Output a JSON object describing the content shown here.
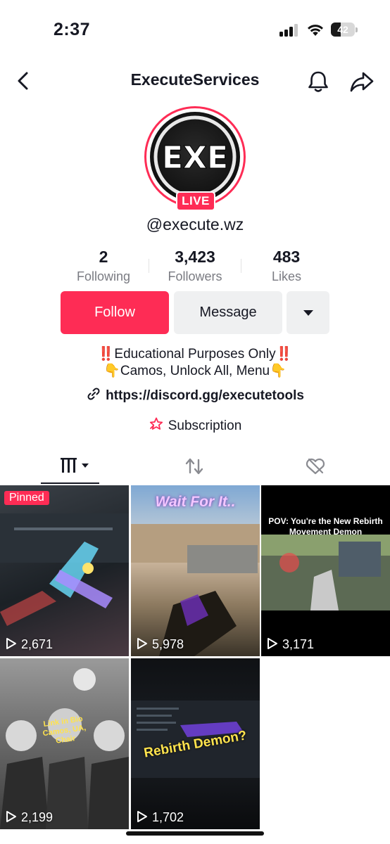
{
  "status_bar": {
    "time": "2:37",
    "battery_level": "42",
    "battery_fraction": 0.42,
    "signal_bars_active": 3
  },
  "header": {
    "title": "ExecuteServices"
  },
  "profile": {
    "live_label": "LIVE",
    "username": "@execute.wz",
    "avatar_logo_text": "EXE",
    "stats": [
      {
        "value": "2",
        "label": "Following"
      },
      {
        "value": "3,423",
        "label": "Followers"
      },
      {
        "value": "483",
        "label": "Likes"
      }
    ],
    "follow_label": "Follow",
    "message_label": "Message",
    "bio_line1": "‼️Educational Purposes Only‼️",
    "bio_line2": "👇Camos, Unlock All, Menu👇",
    "link": "https://discord.gg/executetools",
    "subscription_label": "Subscription"
  },
  "tabs": [
    {
      "icon": "grid-icon",
      "active": true
    },
    {
      "icon": "repost-icon",
      "active": false
    },
    {
      "icon": "liked-hidden-icon",
      "active": false
    }
  ],
  "videos": [
    {
      "views": "2,671",
      "pinned_label": "Pinned",
      "caption": ""
    },
    {
      "views": "5,978",
      "caption": "Wait For It.."
    },
    {
      "views": "3,171",
      "caption": "POV: You're the New Rebirth Movement Demon"
    },
    {
      "views": "2,199",
      "caption": "Link in Bio Camos, UA, Chair"
    },
    {
      "views": "1,702",
      "caption": "Rebirth Demon?"
    }
  ],
  "colors": {
    "accent": "#fe2c55",
    "text": "#161823",
    "muted": "#7a7b82",
    "button_gray": "#eff0f1"
  }
}
